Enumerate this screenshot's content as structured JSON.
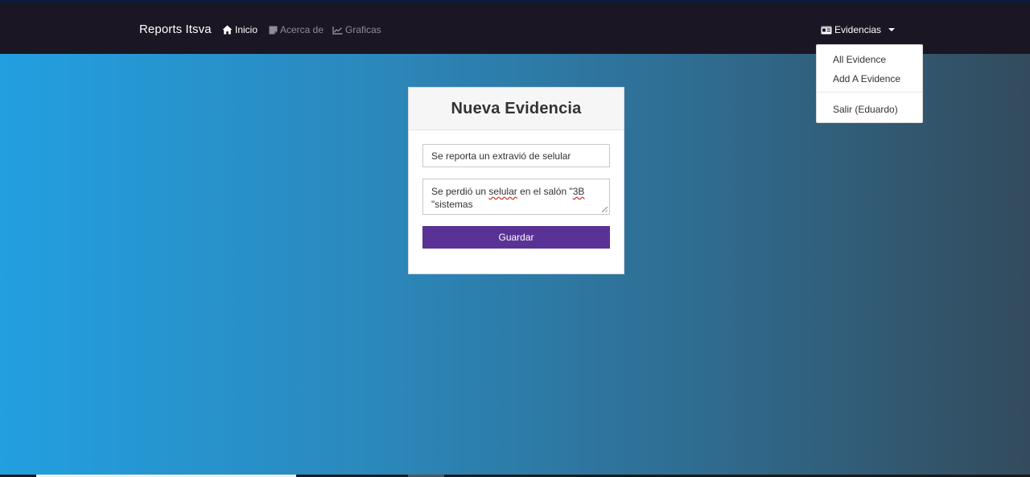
{
  "navbar": {
    "brand": "Reports Itsva",
    "links": [
      {
        "label": "Inicio",
        "icon": "home-icon",
        "active": true
      },
      {
        "label": "Acerca de",
        "icon": "sticky-note-icon",
        "active": false
      },
      {
        "label": "Graficas",
        "icon": "line-chart-icon",
        "active": false
      }
    ],
    "evidencias": {
      "label": "Evidencias",
      "icon": "id-card-icon"
    }
  },
  "dropdown": {
    "items": [
      "All Evidence",
      "Add A Evidence"
    ],
    "logout": "Salir (Eduardo)"
  },
  "form": {
    "title": "Nueva Evidencia",
    "title_value": "Se reporta un extravió de selular",
    "description_parts": [
      "Se perdió un ",
      "selular",
      " en el salón \"",
      "3B",
      "\n\"sistemas"
    ],
    "save_label": "Guardar"
  },
  "colors": {
    "navbar_bg": "#1a1623",
    "accent_button": "#5a3296",
    "gradient_start": "#229fe0",
    "gradient_end": "#334b5c"
  }
}
